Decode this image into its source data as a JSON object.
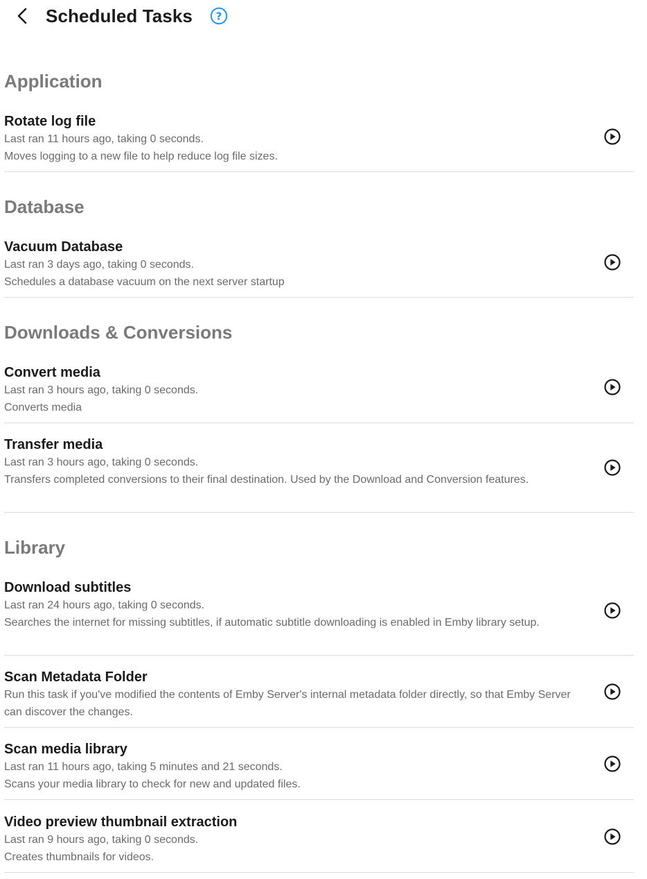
{
  "header": {
    "title": "Scheduled Tasks",
    "back_icon": "chevron-left-icon",
    "help_icon": "help-circle-icon"
  },
  "colors": {
    "help_accent": "#2196f3",
    "section_title": "#7a7a7a",
    "task_title": "#1b1b1b",
    "secondary_text": "#6b6b6b",
    "divider": "#dcdcdc"
  },
  "run_icon": "play-circle-icon",
  "sections": [
    {
      "title": "Application",
      "tasks": [
        {
          "name": "Rotate log file",
          "last_run": "Last ran 11 hours ago, taking 0 seconds.",
          "description": "Moves logging to a new file to help reduce log file sizes."
        }
      ]
    },
    {
      "title": "Database",
      "tasks": [
        {
          "name": "Vacuum Database",
          "last_run": "Last ran 3 days ago, taking 0 seconds.",
          "description": "Schedules a database vacuum on the next server startup"
        }
      ]
    },
    {
      "title": "Downloads & Conversions",
      "tasks": [
        {
          "name": "Convert media",
          "last_run": "Last ran 3 hours ago, taking 0 seconds.",
          "description": "Converts media"
        },
        {
          "name": "Transfer media",
          "last_run": "Last ran 3 hours ago, taking 0 seconds.",
          "description": "Transfers completed conversions to their final destination. Used by the Download and Conversion features."
        }
      ]
    },
    {
      "title": "Library",
      "tasks": [
        {
          "name": "Download subtitles",
          "last_run": "Last ran 24 hours ago, taking 0 seconds.",
          "description": "Searches the internet for missing subtitles, if automatic subtitle downloading is enabled in Emby library setup."
        },
        {
          "name": "Scan Metadata Folder",
          "last_run": "",
          "description": "Run this task if you've modified the contents of Emby Server's internal metadata folder directly, so that Emby Server can discover the changes."
        },
        {
          "name": "Scan media library",
          "last_run": "Last ran 11 hours ago, taking 5 minutes and 21 seconds.",
          "description": "Scans your media library to check for new and updated files."
        },
        {
          "name": "Video preview thumbnail extraction",
          "last_run": "Last ran 9 hours ago, taking 0 seconds.",
          "description": "Creates thumbnails for videos."
        }
      ]
    }
  ]
}
